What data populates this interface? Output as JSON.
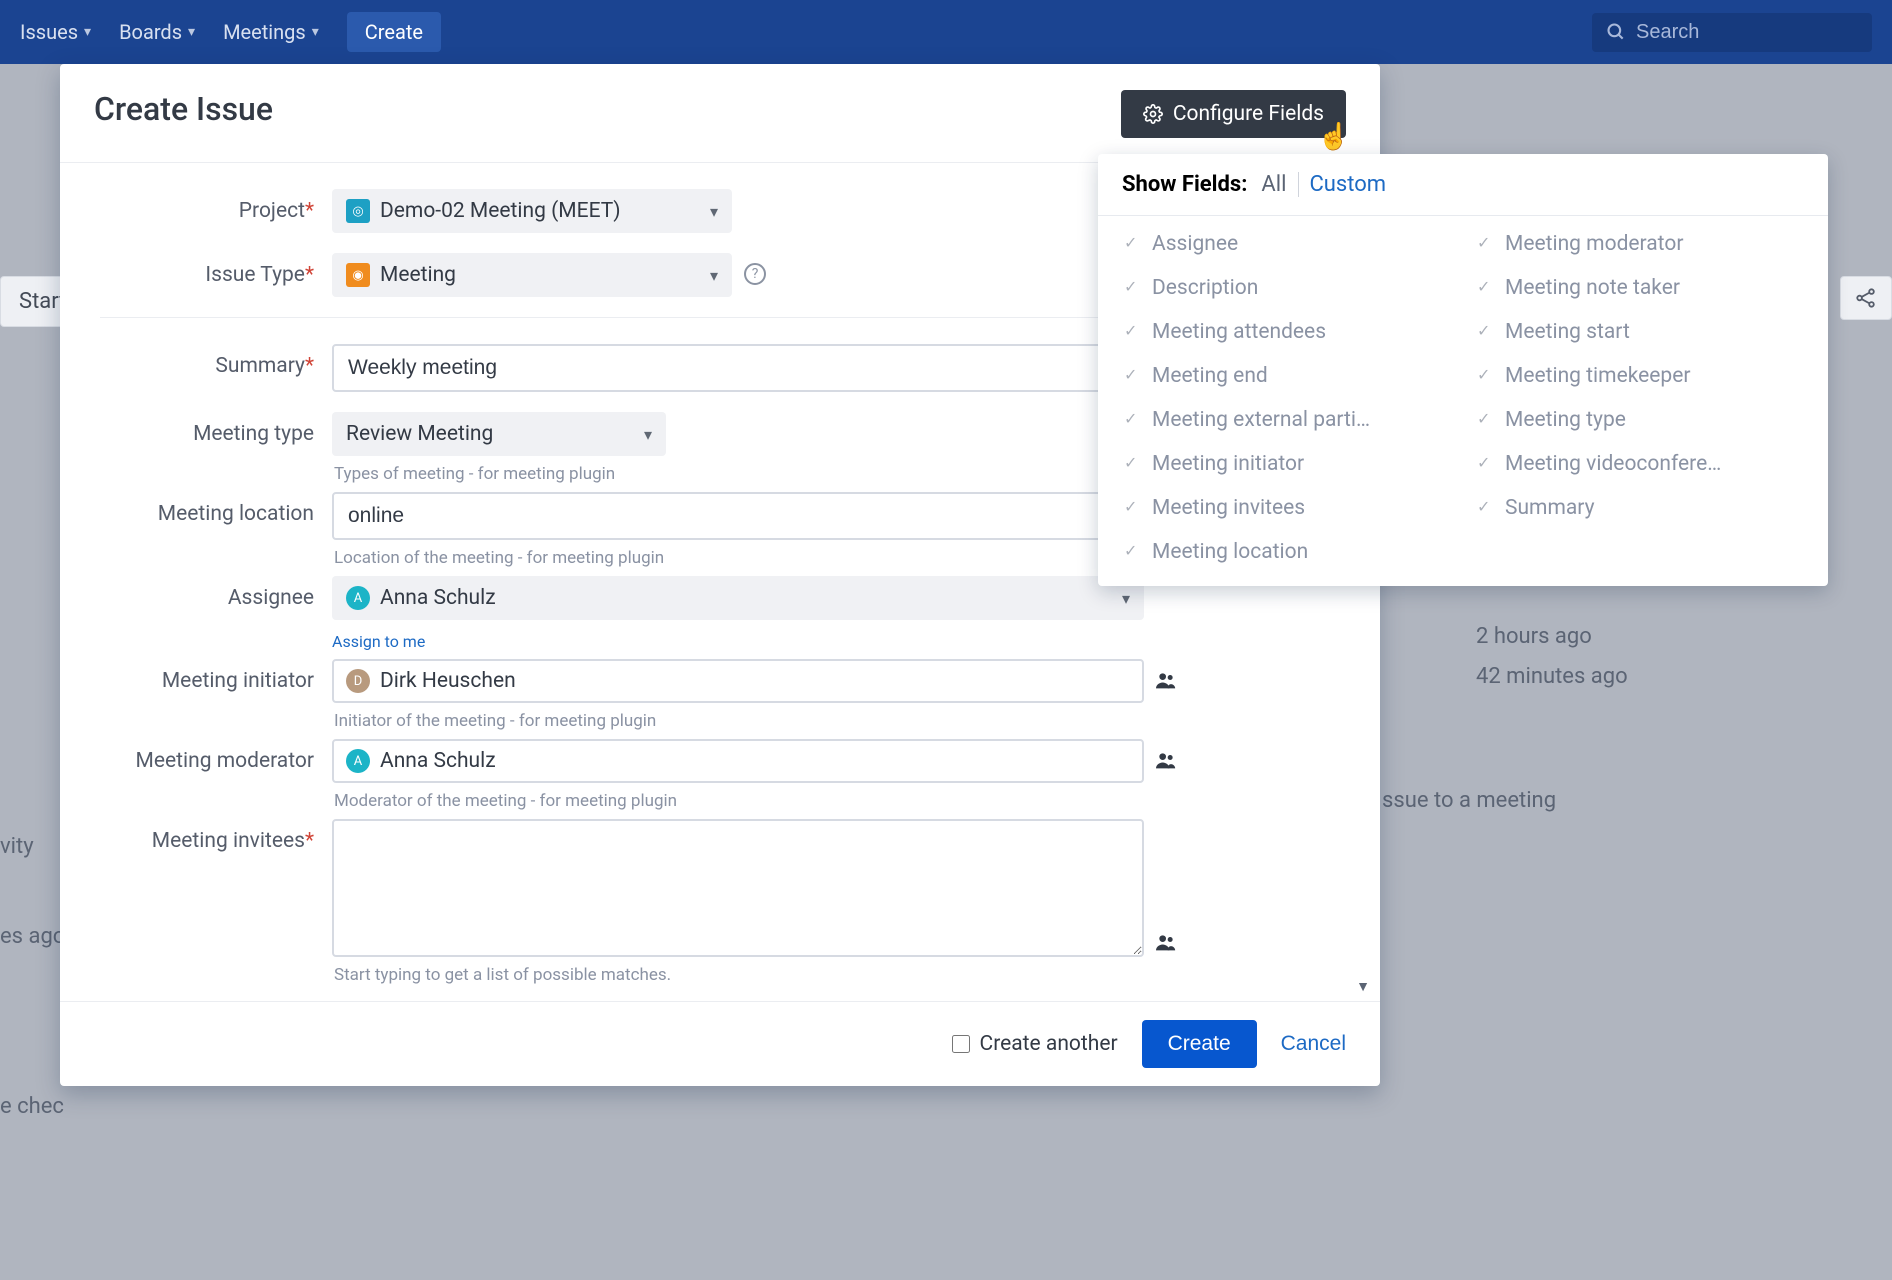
{
  "nav": {
    "issues": "Issues",
    "boards": "Boards",
    "meetings": "Meetings",
    "create": "Create",
    "search_placeholder": "Search"
  },
  "bg": {
    "start": "Start",
    "activity": "vity",
    "ago": "es ago",
    "check": "e chec",
    "hours": "2 hours ago",
    "minutes": "42 minutes ago",
    "issue": "ssue to a meeting"
  },
  "modal": {
    "title": "Create Issue",
    "configure": "Configure Fields"
  },
  "form": {
    "project_label": "Project",
    "project_value": "Demo-02 Meeting (MEET)",
    "issue_type_label": "Issue Type",
    "issue_type_value": "Meeting",
    "summary_label": "Summary",
    "summary_value": "Weekly meeting",
    "meeting_type_label": "Meeting type",
    "meeting_type_value": "Review Meeting",
    "meeting_type_help": "Types of meeting - for meeting plugin",
    "meeting_location_label": "Meeting location",
    "meeting_location_value": "online",
    "meeting_location_help": "Location of the meeting - for meeting plugin",
    "assignee_label": "Assignee",
    "assignee_value": "Anna Schulz",
    "assign_to_me": "Assign to me",
    "initiator_label": "Meeting initiator",
    "initiator_value": "Dirk Heuschen",
    "initiator_help": "Initiator of the meeting - for meeting plugin",
    "moderator_label": "Meeting moderator",
    "moderator_value": "Anna Schulz",
    "moderator_help": "Moderator of the meeting - for meeting plugin",
    "invitees_label": "Meeting invitees",
    "invitees_help": "Start typing to get a list of possible matches."
  },
  "footer": {
    "create_another": "Create another",
    "create": "Create",
    "cancel": "Cancel"
  },
  "dropdown": {
    "show_fields": "Show Fields:",
    "all": "All",
    "custom": "Custom",
    "col1": {
      "f0": "Assignee",
      "f1": "Description",
      "f2": "Meeting attendees",
      "f3": "Meeting end",
      "f4": "Meeting external parti…",
      "f5": "Meeting initiator",
      "f6": "Meeting invitees",
      "f7": "Meeting location"
    },
    "col2": {
      "f0": "Meeting moderator",
      "f1": "Meeting note taker",
      "f2": "Meeting start",
      "f3": "Meeting timekeeper",
      "f4": "Meeting type",
      "f5": "Meeting videoconfere…",
      "f6": "Summary"
    }
  }
}
